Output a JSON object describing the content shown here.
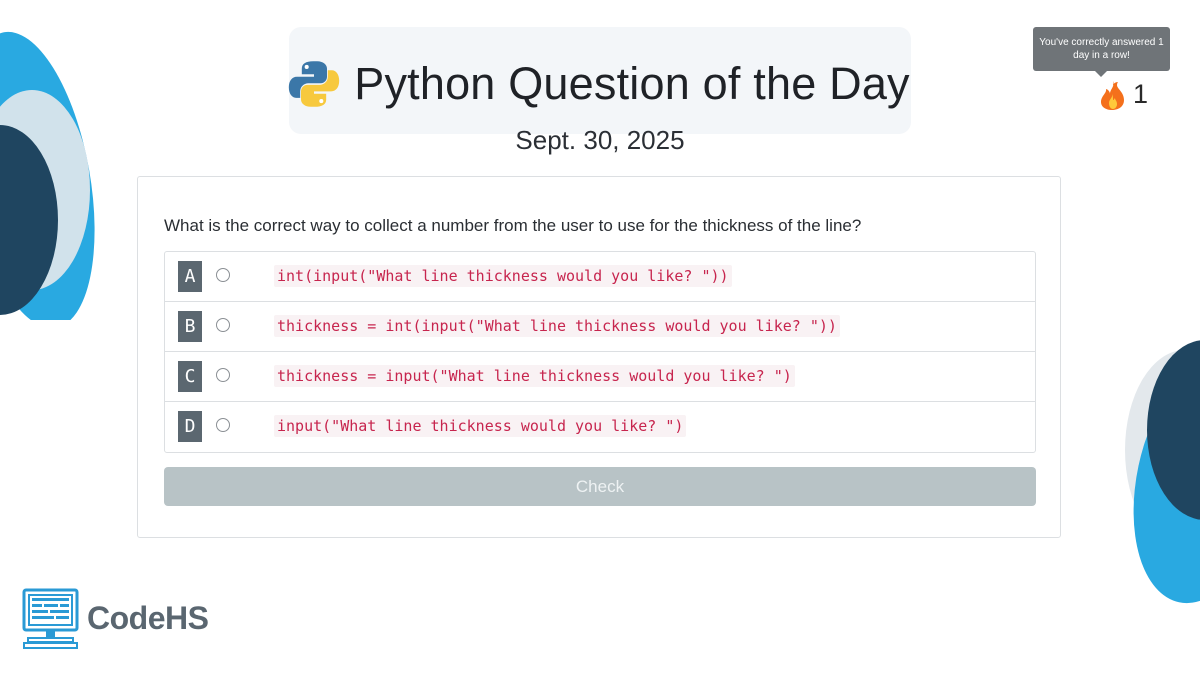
{
  "header": {
    "title": "Python Question of the Day",
    "date": "Sept. 30, 2025",
    "logo_icon": "python-logo-icon"
  },
  "streak": {
    "tooltip": "You've correctly answered 1 day in a row!",
    "icon": "fire-icon",
    "count": "1"
  },
  "question": {
    "text": "What is the correct way to collect a number from the user to use for the thickness of the line?",
    "choices": [
      {
        "letter": "A",
        "code": "int(input(\"What line thickness would you like? \"))"
      },
      {
        "letter": "B",
        "code": "thickness = int(input(\"What line thickness would you like? \"))"
      },
      {
        "letter": "C",
        "code": "thickness = input(\"What line thickness would you like? \")"
      },
      {
        "letter": "D",
        "code": "input(\"What line thickness would you like? \")"
      }
    ],
    "check_label": "Check"
  },
  "brand": {
    "name": "CodeHS",
    "icon": "codehs-monitor-icon"
  },
  "colors": {
    "choice_letter_bg": "#5b6770",
    "code_text": "#c7254e",
    "check_button_bg": "#b8c3c6",
    "blob_light_blue": "#29a9e1",
    "blob_dark_navy": "#1f4560",
    "header_panel_bg": "#f3f6f9"
  }
}
